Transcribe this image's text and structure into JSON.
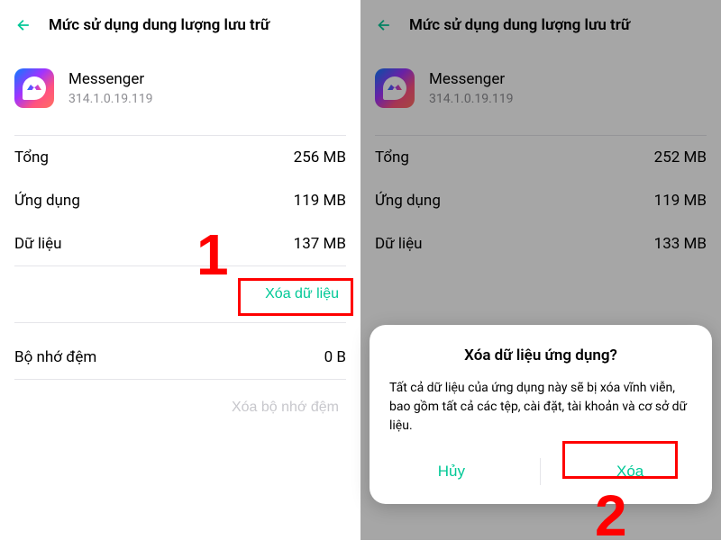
{
  "left": {
    "header_title": "Mức sử dụng dung lượng lưu trữ",
    "app_name": "Messenger",
    "app_version": "314.1.0.19.119",
    "stats": {
      "total_label": "Tổng",
      "total_value": "256 MB",
      "app_label": "Ứng dụng",
      "app_value": "119 MB",
      "data_label": "Dữ liệu",
      "data_value": "137 MB"
    },
    "clear_data": "Xóa dữ liệu",
    "cache_label": "Bộ nhớ đệm",
    "cache_value": "0 B",
    "clear_cache": "Xóa bộ nhớ đệm",
    "step": "1"
  },
  "right": {
    "header_title": "Mức sử dụng dung lượng lưu trữ",
    "app_name": "Messenger",
    "app_version": "314.1.0.19.119",
    "stats": {
      "total_label": "Tổng",
      "total_value": "252 MB",
      "app_label": "Ứng dụng",
      "app_value": "119 MB",
      "data_label": "Dữ liệu",
      "data_value": "133 MB"
    },
    "dialog": {
      "title": "Xóa dữ liệu ứng dụng?",
      "body": "Tất cả dữ liệu của ứng dụng này sẽ bị xóa vĩnh viễn, bao gồm tất cả các tệp, cài đặt, tài khoản và cơ sở dữ liệu.",
      "cancel": "Hủy",
      "confirm": "Xóa"
    },
    "step": "2"
  }
}
